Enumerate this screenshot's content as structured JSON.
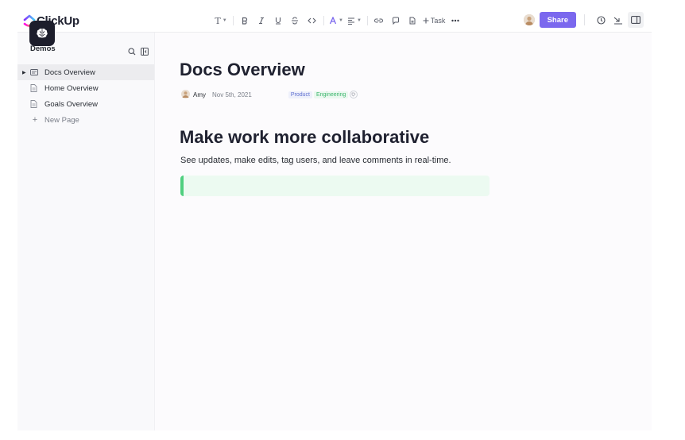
{
  "app": {
    "name": "ClickUp"
  },
  "toolbar": {
    "text_style": "T",
    "task_label": "Task",
    "share_label": "Share"
  },
  "sidebar": {
    "workspace": "Demos",
    "items": [
      {
        "label": "Docs Overview",
        "active": true
      },
      {
        "label": "Home Overview"
      },
      {
        "label": "Goals Overview"
      },
      {
        "label": "New Page"
      }
    ]
  },
  "doc": {
    "title": "Docs Overview",
    "author": "Amy",
    "date": "Nov 5th, 2021",
    "tags": [
      "Product",
      "Engineering"
    ],
    "heading": "Make work more collaborative",
    "paragraph": "See updates, make edits, tag users, and leave comments in real-time."
  },
  "colors": {
    "accent": "#7b68ee",
    "callout_bg": "#ecfaf1",
    "callout_border": "#4fcf7f",
    "tag_product": "#5f6fd0",
    "tag_engineering": "#3bb56c"
  }
}
